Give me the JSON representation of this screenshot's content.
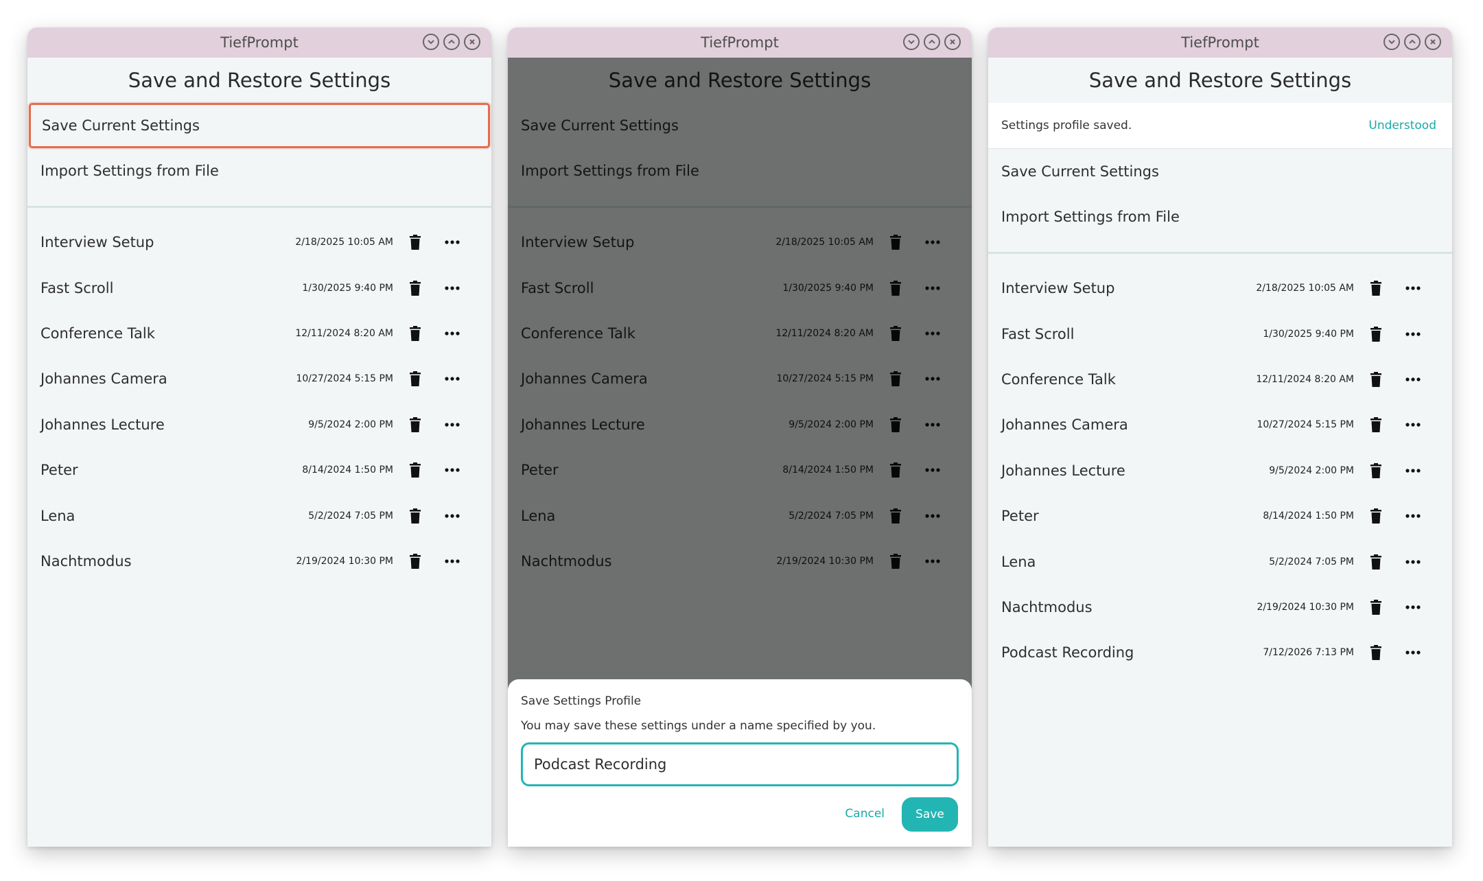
{
  "app_title": "TiefPrompt",
  "heading": "Save and Restore Settings",
  "actions": {
    "save_current": "Save Current Settings",
    "import_file": "Import Settings from File"
  },
  "profiles": [
    {
      "name": "Interview Setup",
      "date": "2/18/2025 10:05 AM"
    },
    {
      "name": "Fast Scroll",
      "date": "1/30/2025 9:40 PM"
    },
    {
      "name": "Conference Talk",
      "date": "12/11/2024 8:20 AM"
    },
    {
      "name": "Johannes Camera",
      "date": "10/27/2024 5:15 PM"
    },
    {
      "name": "Johannes Lecture",
      "date": "9/5/2024 2:00 PM"
    },
    {
      "name": "Peter",
      "date": "8/14/2024 1:50 PM"
    },
    {
      "name": "Lena",
      "date": "5/2/2024 7:05 PM"
    },
    {
      "name": "Nachtmodus",
      "date": "2/19/2024 10:30 PM"
    },
    {
      "name": "Podcast Recording",
      "date": "7/12/2026 7:13 PM"
    }
  ],
  "dialog": {
    "title": "Save Settings Profile",
    "description": "You may save these settings under a name specified by you.",
    "input_value": "Podcast Recording",
    "cancel_label": "Cancel",
    "save_label": "Save"
  },
  "snackbar": {
    "message": "Settings profile saved.",
    "action_label": "Understood"
  },
  "colors": {
    "accent": "#22b5b3",
    "titlebar": "#e2d1dc",
    "focus_ring": "#e36d4f"
  },
  "icons": {
    "minimize": "chevron-down-circle-icon",
    "maximize": "chevron-up-circle-icon",
    "close": "close-circle-icon",
    "delete": "trash-icon",
    "more": "more-horizontal-icon"
  }
}
